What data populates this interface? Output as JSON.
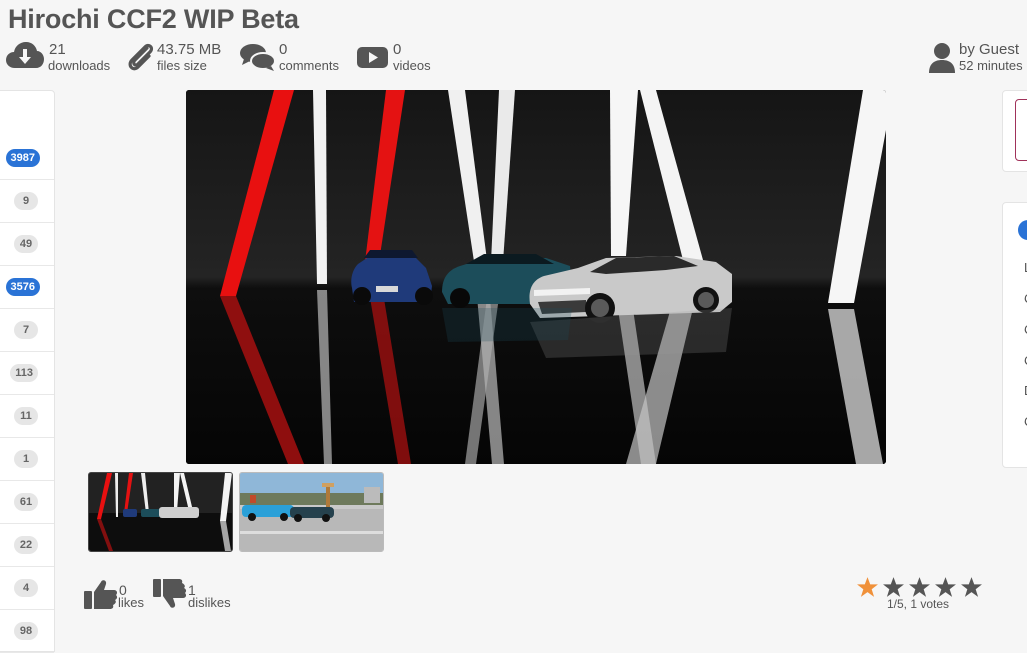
{
  "title": "Hirochi CCF2 WIP Beta",
  "stats": [
    {
      "value": "21",
      "label": "downloads",
      "icon": "download-cloud-icon"
    },
    {
      "value": "43.75 MB",
      "label": "files size",
      "icon": "paperclip-icon"
    },
    {
      "value": "0",
      "label": "comments",
      "icon": "comments-icon"
    },
    {
      "value": "0",
      "label": "videos",
      "icon": "video-play-icon"
    }
  ],
  "author": {
    "by": "by Guest",
    "time": "52 minutes",
    "icon": "user-icon"
  },
  "left_counts": [
    {
      "value": "3987",
      "highlight": true
    },
    {
      "value": "9",
      "highlight": false
    },
    {
      "value": "49",
      "highlight": false
    },
    {
      "value": "3576",
      "highlight": true
    },
    {
      "value": "7",
      "highlight": false
    },
    {
      "value": "113",
      "highlight": false
    },
    {
      "value": "11",
      "highlight": false
    },
    {
      "value": "1",
      "highlight": false
    },
    {
      "value": "61",
      "highlight": false
    },
    {
      "value": "22",
      "highlight": false
    },
    {
      "value": "4",
      "highlight": false
    },
    {
      "value": "98",
      "highlight": false
    }
  ],
  "reactions": {
    "likes": {
      "value": "0",
      "label": "likes",
      "icon": "thumbs-up-icon"
    },
    "dislikes": {
      "value": "1",
      "label": "dislikes",
      "icon": "thumbs-down-icon"
    }
  },
  "rating": {
    "score": 1,
    "max": 5,
    "text": "1/5, 1 votes"
  },
  "right_panel_initials": [
    "L",
    "C",
    "C",
    "C",
    "D",
    "C"
  ],
  "colors": {
    "accent_blue": "#2a73d6",
    "star_active": "#f0913a",
    "star_inactive": "#555555",
    "text": "#555555"
  }
}
